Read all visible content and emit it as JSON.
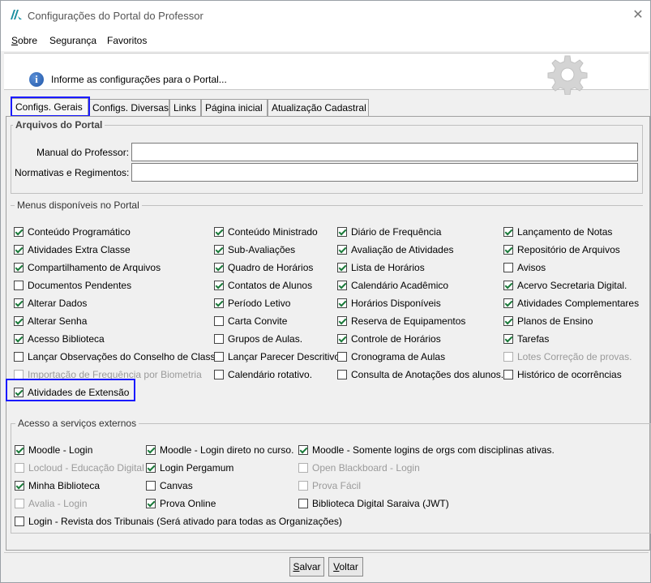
{
  "window": {
    "title": "Configurações do Portal do Professor",
    "close": "✕"
  },
  "menubar": {
    "sobre": "Sobre",
    "seguranca": "Segurança",
    "favoritos": "Favoritos"
  },
  "header": {
    "info": "Informe as configurações para o Portal..."
  },
  "tabs": [
    "Configs. Gerais",
    "Configs. Diversas",
    "Links",
    "Página inicial",
    "Atualização Cadastral"
  ],
  "arquivos": {
    "title": "Arquivos do Portal",
    "manual_label": "Manual do Professor:",
    "manual_value": "",
    "normativas_label": "Normativas e Regimentos:",
    "normativas_value": ""
  },
  "menus": {
    "title": "Menus disponíveis no Portal",
    "items": [
      {
        "label": "Conteúdo Programático",
        "checked": true,
        "disabled": false
      },
      {
        "label": "Conteúdo Ministrado",
        "checked": true,
        "disabled": false
      },
      {
        "label": "Diário de Frequência",
        "checked": true,
        "disabled": false
      },
      {
        "label": "Lançamento de Notas",
        "checked": true,
        "disabled": false
      },
      {
        "label": "Atividades Extra Classe",
        "checked": true,
        "disabled": false
      },
      {
        "label": "Sub-Avaliações",
        "checked": true,
        "disabled": false
      },
      {
        "label": "Avaliação de Atividades",
        "checked": true,
        "disabled": false
      },
      {
        "label": "Repositório de Arquivos",
        "checked": true,
        "disabled": false
      },
      {
        "label": "Compartilhamento de Arquivos",
        "checked": true,
        "disabled": false
      },
      {
        "label": "Quadro de Horários",
        "checked": true,
        "disabled": false
      },
      {
        "label": "Lista de Horários",
        "checked": true,
        "disabled": false
      },
      {
        "label": "Avisos",
        "checked": false,
        "disabled": false
      },
      {
        "label": "Documentos Pendentes",
        "checked": false,
        "disabled": false
      },
      {
        "label": "Contatos de Alunos",
        "checked": true,
        "disabled": false
      },
      {
        "label": "Calendário Acadêmico",
        "checked": true,
        "disabled": false
      },
      {
        "label": "Acervo Secretaria Digital.",
        "checked": true,
        "disabled": false
      },
      {
        "label": "Alterar Dados",
        "checked": true,
        "disabled": false
      },
      {
        "label": "Período Letivo",
        "checked": true,
        "disabled": false
      },
      {
        "label": "Horários Disponíveis",
        "checked": true,
        "disabled": false
      },
      {
        "label": "Atividades Complementares",
        "checked": true,
        "disabled": false
      },
      {
        "label": "Alterar Senha",
        "checked": true,
        "disabled": false
      },
      {
        "label": "Carta Convite",
        "checked": false,
        "disabled": false
      },
      {
        "label": "Reserva de Equipamentos",
        "checked": true,
        "disabled": false
      },
      {
        "label": "Planos de Ensino",
        "checked": true,
        "disabled": false
      },
      {
        "label": "Acesso Biblioteca",
        "checked": true,
        "disabled": false
      },
      {
        "label": "Grupos de Aulas.",
        "checked": false,
        "disabled": false
      },
      {
        "label": "Controle de Horários",
        "checked": true,
        "disabled": false
      },
      {
        "label": "Tarefas",
        "checked": true,
        "disabled": false
      },
      {
        "label": "Lançar Observações do Conselho de Classe",
        "checked": false,
        "disabled": false
      },
      {
        "label": "Lançar Parecer Descritivo",
        "checked": false,
        "disabled": false
      },
      {
        "label": "Cronograma de Aulas",
        "checked": false,
        "disabled": false
      },
      {
        "label": "Lotes Correção de provas.",
        "checked": false,
        "disabled": true
      },
      {
        "label": "Importação de Frequência por Biometria",
        "checked": false,
        "disabled": true
      },
      {
        "label": "Calendário rotativo.",
        "checked": false,
        "disabled": false
      },
      {
        "label": "Consulta de Anotações dos alunos.",
        "checked": false,
        "disabled": false
      },
      {
        "label": "Histórico de ocorrências",
        "checked": false,
        "disabled": false
      },
      {
        "label": "Atividades de Extensão",
        "checked": true,
        "disabled": false
      }
    ]
  },
  "externos": {
    "title": "Acesso a serviços externos",
    "items": [
      {
        "label": "Moodle - Login",
        "checked": true,
        "disabled": false
      },
      {
        "label": "Moodle - Login direto no curso.",
        "checked": true,
        "disabled": false
      },
      {
        "label": "Moodle - Somente logins de orgs com disciplinas ativas.",
        "checked": true,
        "disabled": false
      },
      {
        "label": "Locloud - Educação Digital",
        "checked": false,
        "disabled": true
      },
      {
        "label": "Login Pergamum",
        "checked": true,
        "disabled": false
      },
      {
        "label": "Open Blackboard - Login",
        "checked": false,
        "disabled": true
      },
      {
        "label": "Minha Biblioteca",
        "checked": true,
        "disabled": false
      },
      {
        "label": "Canvas",
        "checked": false,
        "disabled": false
      },
      {
        "label": "Prova Fácil",
        "checked": false,
        "disabled": true
      },
      {
        "label": "Avalia - Login",
        "checked": false,
        "disabled": true
      },
      {
        "label": "Prova Online",
        "checked": true,
        "disabled": false
      },
      {
        "label": "Biblioteca Digital Saraiva (JWT)",
        "checked": false,
        "disabled": false
      },
      {
        "label": "Login - Revista dos Tribunais (Será ativado para todas as Organizações)",
        "checked": false,
        "disabled": false
      }
    ]
  },
  "buttons": {
    "salvar_u": "S",
    "salvar_rest": "alvar",
    "voltar_u": "V",
    "voltar_rest": "oltar"
  }
}
